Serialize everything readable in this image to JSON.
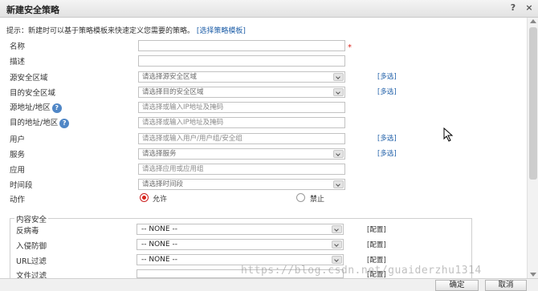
{
  "dialog": {
    "title": "新建安全策略",
    "help_icon": "?",
    "close_icon": "×"
  },
  "hint": {
    "text": "提示：新建时可以基于策略模板来快速定义您需要的策略。",
    "link": "[选择策略模板]"
  },
  "fields": {
    "name": {
      "label": "名称",
      "value": ""
    },
    "description": {
      "label": "描述",
      "value": ""
    },
    "src_zone": {
      "label": "源安全区域",
      "placeholder": "请选择源安全区域",
      "multi": "[多选]"
    },
    "dst_zone": {
      "label": "目的安全区域",
      "placeholder": "请选择目的安全区域",
      "multi": "[多选]"
    },
    "src_addr": {
      "label": "源地址/地区",
      "placeholder": "请选择或输入IP地址及掩码"
    },
    "dst_addr": {
      "label": "目的地址/地区",
      "placeholder": "请选择或输入IP地址及掩码"
    },
    "user": {
      "label": "用户",
      "placeholder": "请选择或输入用户/用户组/安全组",
      "multi": "[多选]"
    },
    "service": {
      "label": "服务",
      "placeholder": "请选择服务",
      "multi": "[多选]"
    },
    "application": {
      "label": "应用",
      "placeholder": "请选择应用或应用组"
    },
    "schedule": {
      "label": "时间段",
      "placeholder": "请选择时间段"
    },
    "action": {
      "label": "动作",
      "permit": "允许",
      "deny": "禁止",
      "selected": "permit"
    }
  },
  "content_security": {
    "legend": "内容安全",
    "rows": [
      {
        "label": "反病毒",
        "value": "-- NONE --",
        "config": "[配置]"
      },
      {
        "label": "入侵防御",
        "value": "-- NONE --",
        "config": "[配置]"
      },
      {
        "label": "URL过滤",
        "value": "-- NONE --",
        "config": "[配置]"
      },
      {
        "label": "文件过滤",
        "value": "",
        "config": "[配置]"
      }
    ]
  },
  "buttons": {
    "ok": "确定",
    "cancel": "取消"
  },
  "watermark": "https://blog.csdn.net/guaiderzhu1314"
}
